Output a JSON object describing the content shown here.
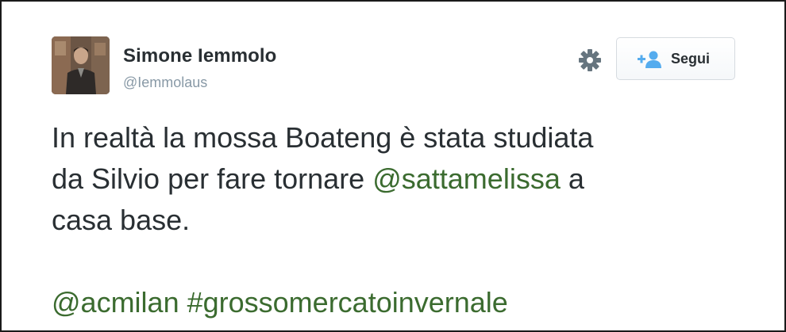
{
  "author": {
    "name": "Simone Iemmolo",
    "handle": "@Iemmolaus"
  },
  "actions": {
    "settings_icon": "gear-icon",
    "follow_icon": "add-user-icon",
    "follow_label": "Segui"
  },
  "tweet": {
    "line1": "In realtà la mossa Boateng è stata studiata",
    "line2_prefix": "da Silvio per fare tornare ",
    "line2_mention": "@sattamelissa",
    "line2_suffix": " a",
    "line3": "casa base.",
    "mention_acmilan": "@acmilan",
    "space": " ",
    "hashtag": "#grossomercatoinvernale"
  },
  "colors": {
    "text": "#292f33",
    "handle": "#8899a6",
    "link": "#3b6b2f",
    "follow_icon": "#55acee",
    "gear": "#66757f"
  }
}
